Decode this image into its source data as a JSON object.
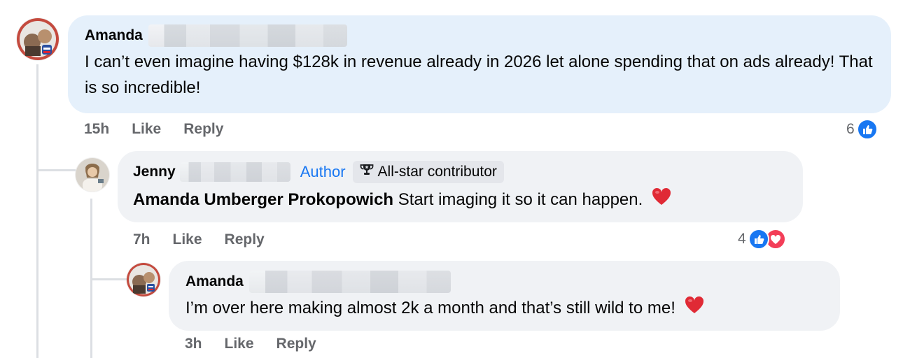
{
  "comments": [
    {
      "author": "Amanda",
      "text": "I can’t even imagine having $128k in revenue already in 2026 let alone spending that on ads already! That is so incredible!",
      "time": "15h",
      "like_label": "Like",
      "reply_label": "Reply",
      "reaction_count": "6"
    },
    {
      "author": "Jenny",
      "author_badge": "Author",
      "contributor_badge": "All-star contributor",
      "mention": "Amanda Umberger Prokopowich",
      "text": "Start imaging it so it can happen.",
      "time": "7h",
      "like_label": "Like",
      "reply_label": "Reply",
      "reaction_count": "4"
    },
    {
      "author": "Amanda",
      "text": "I’m over here making almost 2k a month and that’s still wild to me!",
      "time": "3h",
      "like_label": "Like",
      "reply_label": "Reply"
    }
  ],
  "colors": {
    "highlight_bubble": "#e5f0fb",
    "bubble": "#f0f2f5",
    "link_blue": "#1877f2",
    "love_red": "#f33e58",
    "muted": "#65676b"
  }
}
